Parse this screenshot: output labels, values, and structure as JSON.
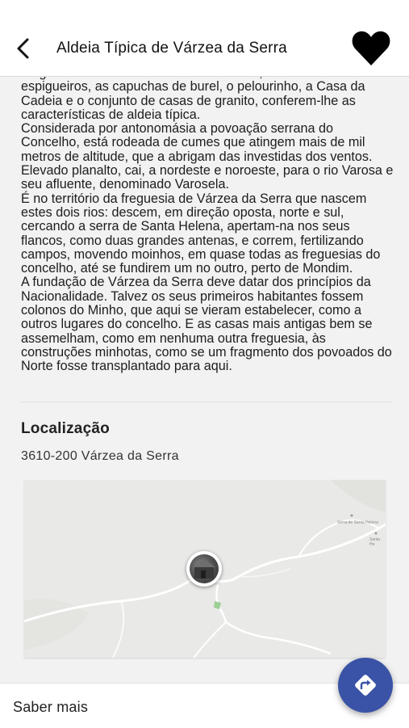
{
  "header": {
    "title": "Aldeia Típica de Várzea da Serra",
    "back_icon": "chevron-left-icon",
    "favorite_icon": "heart-icon"
  },
  "description": {
    "paragraphs": [
      "de grande interesse. O ambiente serrano, os canastros ou espigueiros, as capuchas de burel, o pelourinho, a Casa da Cadeia e o conjunto de casas de granito, conferem-lhe as características de aldeia típica.",
      "Considerada por antonomásia a povoação serrana do Concelho, está rodeada de cumes que atingem mais de mil metros de altitude, que a abrigam das investidas dos ventos. Elevado planalto, cai, a nordeste e noroeste, para o rio Varosa e seu afluente, denominado Varosela.",
      "É no território da freguesia de Várzea da Serra que nascem estes dois rios: descem, em direção oposta, norte e sul, cercando a serra de Santa Helena, apertam-na nos seus flancos, como duas grandes antenas, e correm, fertilizando campos, movendo moinhos, em quase todas as freguesias do concelho, até se fundirem um no outro, perto de Mondim.",
      "A fundação de Várzea da Serra deve datar dos princípios da Nacionalidade. Talvez os seus primeiros habitantes fossem colonos do Minho, que aqui se vieram estabelecer, como a outros lugares do concelho. E as casas mais antigas bem se assemelham, como em nenhuma outra freguesia, às construções minhotas, como se um fragmento dos povoados do Norte fosse transplantado para aqui."
    ]
  },
  "location": {
    "title": "Localização",
    "address": "3610-200 Várzea da Serra",
    "map": {
      "label_1": "Serra de Santa Helena",
      "label_2": "Santa He"
    }
  },
  "footer": {
    "more_label": "Saber mais",
    "directions_icon": "directions-icon",
    "accent_color": "#3a53a6"
  }
}
